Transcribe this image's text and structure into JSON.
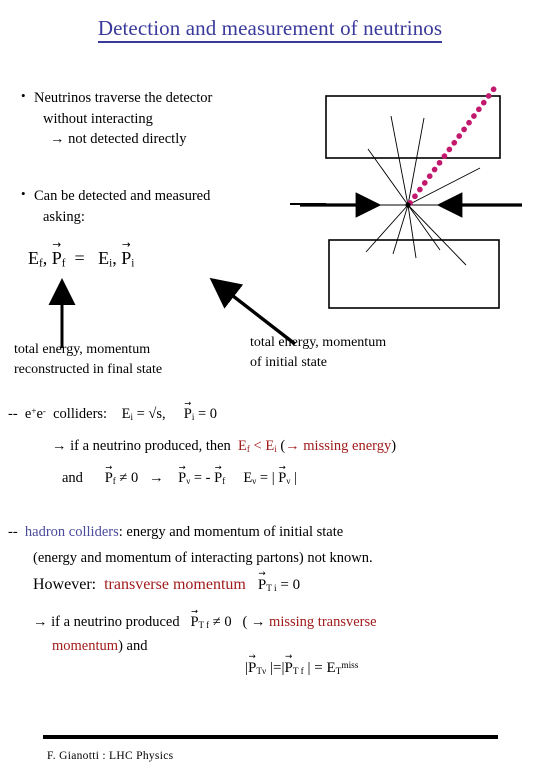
{
  "slide": {
    "title": "Detection and measurement of neutrinos",
    "footer": "F. Gianotti : LHC Physics"
  },
  "colors": {
    "title_blue": "#3a3a9c",
    "accent_red": "#a01b1b",
    "link_blue": "#4a4a9c",
    "neutrino_magenta": "#c2186e",
    "text_black": "#000000"
  },
  "bullets": [
    {
      "marker": "bullet-dot",
      "line1": "Neutrinos traverse the detector",
      "line2": "without interacting",
      "line3": "® not detected directly",
      "arrow": "→"
    },
    {
      "marker": "bullet-dot",
      "line1": "Can be detected and  measured",
      "line2": "asking:"
    }
  ],
  "equation_main": {
    "lhs_E": "E",
    "lhs_E_sub": "f",
    "comma": ",",
    "lhs_P": "P",
    "lhs_P_sub": "f",
    "equals": "=",
    "rhs_E": "E",
    "rhs_E_sub": "i",
    "rhs_P": "P",
    "rhs_P_sub": "i",
    "vector_arrow": "→"
  },
  "captions": {
    "left_line1": "total energy, momentum",
    "left_line2": "reconstructed in final state",
    "right_line1": "total energy, momentum",
    "right_line2": "of initial state"
  },
  "ee_section": {
    "dash": "--",
    "label_e": "e",
    "label_plus": "+",
    "label_e2": "e",
    "label_minus": "-",
    "label_colliders": "colliders:",
    "eq_E": "E",
    "eq_E_sub": "i",
    "eq_equals": "=",
    "eq_sqrt_s": "√s,",
    "eq_P": "P",
    "eq_P_sub": "i",
    "eq_P_val": "= 0",
    "line2_arrow": "→",
    "line2_text": "if a neutrino produced, then",
    "line2_Ef": "E",
    "line2_Ef_sub": "f",
    "line2_lt": "<",
    "line2_Ei": "E",
    "line2_Ei_sub": "i",
    "line2_paren_open": "(",
    "line2_arrow2": "→",
    "line2_missing": "missing energy",
    "line2_paren_close": ")",
    "line3_and": "and",
    "line3_Pf": "P",
    "line3_Pf_sub": "f",
    "line3_neq": "≠ 0",
    "line3_arrow": "→",
    "line3_Pnu": "P",
    "line3_Pnu_sub": "ν",
    "line3_eq_neg": "= -",
    "line3_Pf2": "P",
    "line3_Pf2_sub": "f",
    "line3_Enu": "E",
    "line3_Enu_sub": "ν",
    "line3_eq2": "= |",
    "line3_Pnu2": "P",
    "line3_Pnu2_sub": "ν",
    "line3_bar": "|"
  },
  "hadron_section": {
    "dash": "--",
    "label": "hadron colliders",
    "text_after": ": energy and momentum of  initial state",
    "line2": "(energy and momentum of interacting  partons) not known.",
    "however": "However:",
    "transverse": "transverse momentum",
    "pt_P": "P",
    "pt_sub": "T i",
    "pt_val": "= 0",
    "line_nu_arrow": "→",
    "line_nu_text": "if a neutrino produced",
    "line_nu_P": "P",
    "line_nu_P_sub": "T f",
    "line_nu_neq": "≠ 0",
    "line_nu_paren": "(",
    "line_nu_arrow2": "→",
    "line_nu_missing": "missing transverse",
    "line_nu2_missing": "momentum",
    "line_nu2_paren": ")  and",
    "final_bar1": "|",
    "final_P1": "P",
    "final_P1_sub": "Tν",
    "final_bar2": "|=|",
    "final_P2": "P",
    "final_P2_sub": "T f",
    "final_bar3": "|",
    "final_eq": "=",
    "final_E": "E",
    "final_E_sub": "T",
    "final_E_sup": "miss"
  },
  "diagram": {
    "name": "collision-event-diagram",
    "upper_detector": "upper-detector-block",
    "lower_detector": "lower-detector-block",
    "beam_left": "incoming-beam-left-arrow",
    "beam_right": "incoming-beam-right-arrow",
    "vertex": "interaction-vertex",
    "neutrino_track": "neutrino-dotted-track",
    "track_count": 9
  }
}
